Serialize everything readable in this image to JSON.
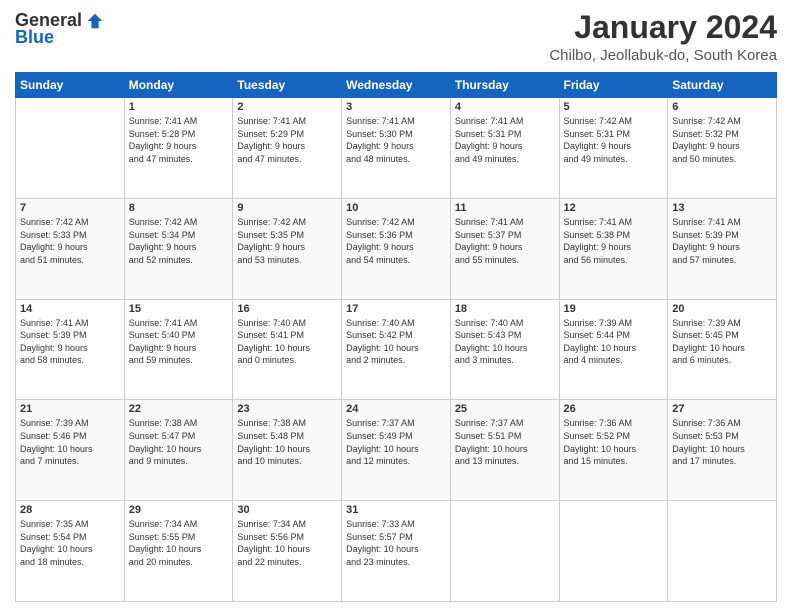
{
  "logo": {
    "general": "General",
    "blue": "Blue"
  },
  "title": "January 2024",
  "subtitle": "Chilbo, Jeollabuk-do, South Korea",
  "days_of_week": [
    "Sunday",
    "Monday",
    "Tuesday",
    "Wednesday",
    "Thursday",
    "Friday",
    "Saturday"
  ],
  "weeks": [
    [
      {
        "day": "",
        "info": ""
      },
      {
        "day": "1",
        "info": "Sunrise: 7:41 AM\nSunset: 5:28 PM\nDaylight: 9 hours\nand 47 minutes."
      },
      {
        "day": "2",
        "info": "Sunrise: 7:41 AM\nSunset: 5:29 PM\nDaylight: 9 hours\nand 47 minutes."
      },
      {
        "day": "3",
        "info": "Sunrise: 7:41 AM\nSunset: 5:30 PM\nDaylight: 9 hours\nand 48 minutes."
      },
      {
        "day": "4",
        "info": "Sunrise: 7:41 AM\nSunset: 5:31 PM\nDaylight: 9 hours\nand 49 minutes."
      },
      {
        "day": "5",
        "info": "Sunrise: 7:42 AM\nSunset: 5:31 PM\nDaylight: 9 hours\nand 49 minutes."
      },
      {
        "day": "6",
        "info": "Sunrise: 7:42 AM\nSunset: 5:32 PM\nDaylight: 9 hours\nand 50 minutes."
      }
    ],
    [
      {
        "day": "7",
        "info": "Sunrise: 7:42 AM\nSunset: 5:33 PM\nDaylight: 9 hours\nand 51 minutes."
      },
      {
        "day": "8",
        "info": "Sunrise: 7:42 AM\nSunset: 5:34 PM\nDaylight: 9 hours\nand 52 minutes."
      },
      {
        "day": "9",
        "info": "Sunrise: 7:42 AM\nSunset: 5:35 PM\nDaylight: 9 hours\nand 53 minutes."
      },
      {
        "day": "10",
        "info": "Sunrise: 7:42 AM\nSunset: 5:36 PM\nDaylight: 9 hours\nand 54 minutes."
      },
      {
        "day": "11",
        "info": "Sunrise: 7:41 AM\nSunset: 5:37 PM\nDaylight: 9 hours\nand 55 minutes."
      },
      {
        "day": "12",
        "info": "Sunrise: 7:41 AM\nSunset: 5:38 PM\nDaylight: 9 hours\nand 56 minutes."
      },
      {
        "day": "13",
        "info": "Sunrise: 7:41 AM\nSunset: 5:39 PM\nDaylight: 9 hours\nand 57 minutes."
      }
    ],
    [
      {
        "day": "14",
        "info": "Sunrise: 7:41 AM\nSunset: 5:39 PM\nDaylight: 9 hours\nand 58 minutes."
      },
      {
        "day": "15",
        "info": "Sunrise: 7:41 AM\nSunset: 5:40 PM\nDaylight: 9 hours\nand 59 minutes."
      },
      {
        "day": "16",
        "info": "Sunrise: 7:40 AM\nSunset: 5:41 PM\nDaylight: 10 hours\nand 0 minutes."
      },
      {
        "day": "17",
        "info": "Sunrise: 7:40 AM\nSunset: 5:42 PM\nDaylight: 10 hours\nand 2 minutes."
      },
      {
        "day": "18",
        "info": "Sunrise: 7:40 AM\nSunset: 5:43 PM\nDaylight: 10 hours\nand 3 minutes."
      },
      {
        "day": "19",
        "info": "Sunrise: 7:39 AM\nSunset: 5:44 PM\nDaylight: 10 hours\nand 4 minutes."
      },
      {
        "day": "20",
        "info": "Sunrise: 7:39 AM\nSunset: 5:45 PM\nDaylight: 10 hours\nand 6 minutes."
      }
    ],
    [
      {
        "day": "21",
        "info": "Sunrise: 7:39 AM\nSunset: 5:46 PM\nDaylight: 10 hours\nand 7 minutes."
      },
      {
        "day": "22",
        "info": "Sunrise: 7:38 AM\nSunset: 5:47 PM\nDaylight: 10 hours\nand 9 minutes."
      },
      {
        "day": "23",
        "info": "Sunrise: 7:38 AM\nSunset: 5:48 PM\nDaylight: 10 hours\nand 10 minutes."
      },
      {
        "day": "24",
        "info": "Sunrise: 7:37 AM\nSunset: 5:49 PM\nDaylight: 10 hours\nand 12 minutes."
      },
      {
        "day": "25",
        "info": "Sunrise: 7:37 AM\nSunset: 5:51 PM\nDaylight: 10 hours\nand 13 minutes."
      },
      {
        "day": "26",
        "info": "Sunrise: 7:36 AM\nSunset: 5:52 PM\nDaylight: 10 hours\nand 15 minutes."
      },
      {
        "day": "27",
        "info": "Sunrise: 7:36 AM\nSunset: 5:53 PM\nDaylight: 10 hours\nand 17 minutes."
      }
    ],
    [
      {
        "day": "28",
        "info": "Sunrise: 7:35 AM\nSunset: 5:54 PM\nDaylight: 10 hours\nand 18 minutes."
      },
      {
        "day": "29",
        "info": "Sunrise: 7:34 AM\nSunset: 5:55 PM\nDaylight: 10 hours\nand 20 minutes."
      },
      {
        "day": "30",
        "info": "Sunrise: 7:34 AM\nSunset: 5:56 PM\nDaylight: 10 hours\nand 22 minutes."
      },
      {
        "day": "31",
        "info": "Sunrise: 7:33 AM\nSunset: 5:57 PM\nDaylight: 10 hours\nand 23 minutes."
      },
      {
        "day": "",
        "info": ""
      },
      {
        "day": "",
        "info": ""
      },
      {
        "day": "",
        "info": ""
      }
    ]
  ]
}
